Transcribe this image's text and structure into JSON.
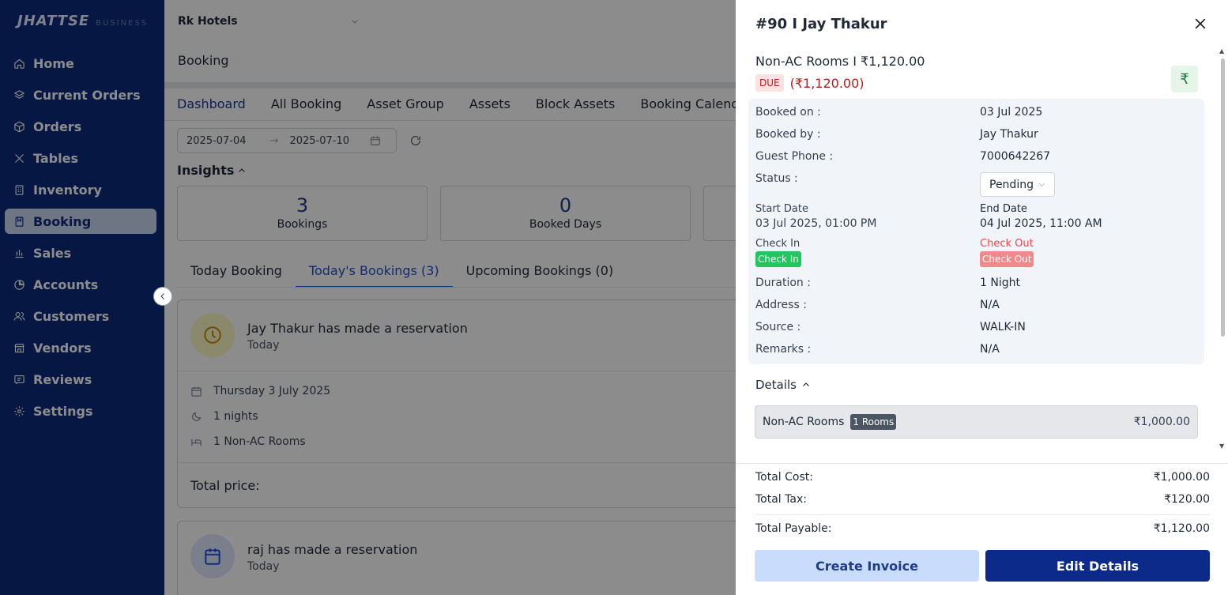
{
  "sidebar": {
    "brand": "JHATTSE",
    "brand_sub": "BUSINESS",
    "items": [
      {
        "label": "Home",
        "icon": "home-icon"
      },
      {
        "label": "Current Orders",
        "icon": "layers-icon"
      },
      {
        "label": "Orders",
        "icon": "box-icon"
      },
      {
        "label": "Tables",
        "icon": "utensils-icon"
      },
      {
        "label": "Inventory",
        "icon": "building-icon"
      },
      {
        "label": "Booking",
        "icon": "bookmark-icon",
        "active": true
      },
      {
        "label": "Sales",
        "icon": "bar-chart-icon"
      },
      {
        "label": "Accounts",
        "icon": "pie-chart-icon"
      },
      {
        "label": "Customers",
        "icon": "users-icon"
      },
      {
        "label": "Vendors",
        "icon": "store-icon"
      },
      {
        "label": "Reviews",
        "icon": "review-icon"
      },
      {
        "label": "Settings",
        "icon": "gear-icon"
      }
    ]
  },
  "main": {
    "hotel": "Rk Hotels",
    "page_title": "Booking",
    "subtabs": [
      "Dashboard",
      "All Booking",
      "Asset Group",
      "Assets",
      "Block Assets",
      "Booking Calendar"
    ],
    "date_from": "2025-07-04",
    "date_to": "2025-07-10",
    "insights_label": "Insights",
    "stats": [
      {
        "value": "3",
        "label": "Bookings"
      },
      {
        "value": "0",
        "label": "Booked Days"
      }
    ],
    "booking_tabs": [
      "Today Booking",
      "Today's Bookings (3)",
      "Upcoming Bookings (0)"
    ],
    "cards": [
      {
        "title": "Jay Thakur has made a reservation",
        "when": "Today",
        "date": "Thursday 3 July 2025",
        "nights": "1 nights",
        "rooms": "1 Non-AC Rooms",
        "total_label": "Total price:"
      },
      {
        "title": "raj has made a reservation",
        "when": "Today"
      }
    ]
  },
  "drawer": {
    "title": "#90 I Jay Thakur",
    "room_line": "Non-AC Rooms I ₹1,120.00",
    "due_badge": "DUE",
    "due_amount": "(₹1,120.00)",
    "rupee_symbol": "₹",
    "info": {
      "booked_on_label": "Booked on :",
      "booked_on": "03 Jul 2025",
      "booked_by_label": "Booked by :",
      "booked_by": "Jay Thakur",
      "phone_label": "Guest Phone :",
      "phone": "7000642267",
      "status_label": "Status :",
      "status": "Pending",
      "start_label": "Start Date",
      "start": "03 Jul 2025, 01:00 PM",
      "end_label": "End Date",
      "end": "04 Jul 2025, 11:00 AM",
      "checkin_label": "Check In",
      "checkin_btn": "Check In",
      "checkout_label": "Check Out",
      "checkout_btn": "Check Out",
      "duration_label": "Duration :",
      "duration": "1 Night",
      "address_label": "Address :",
      "address": "N/A",
      "source_label": "Source :",
      "source": "WALK-IN",
      "remarks_label": "Remarks :",
      "remarks": "N/A"
    },
    "details_label": "Details",
    "detail_item": {
      "name": "Non-AC Rooms",
      "badge": "1 Rooms",
      "amount": "₹1,000.00"
    },
    "totals": {
      "cost_label": "Total Cost:",
      "cost": "₹1,000.00",
      "tax_label": "Total Tax:",
      "tax": "₹120.00",
      "payable_label": "Total Payable:",
      "payable": "₹1,120.00"
    },
    "create_invoice": "Create Invoice",
    "edit_details": "Edit Details"
  },
  "colors": {
    "sidebar_bg": "#0b2a7a",
    "accent": "#1e3a8a",
    "due": "#b91c1c",
    "checkin": "#22c55e",
    "checkout": "#f08a8a"
  }
}
